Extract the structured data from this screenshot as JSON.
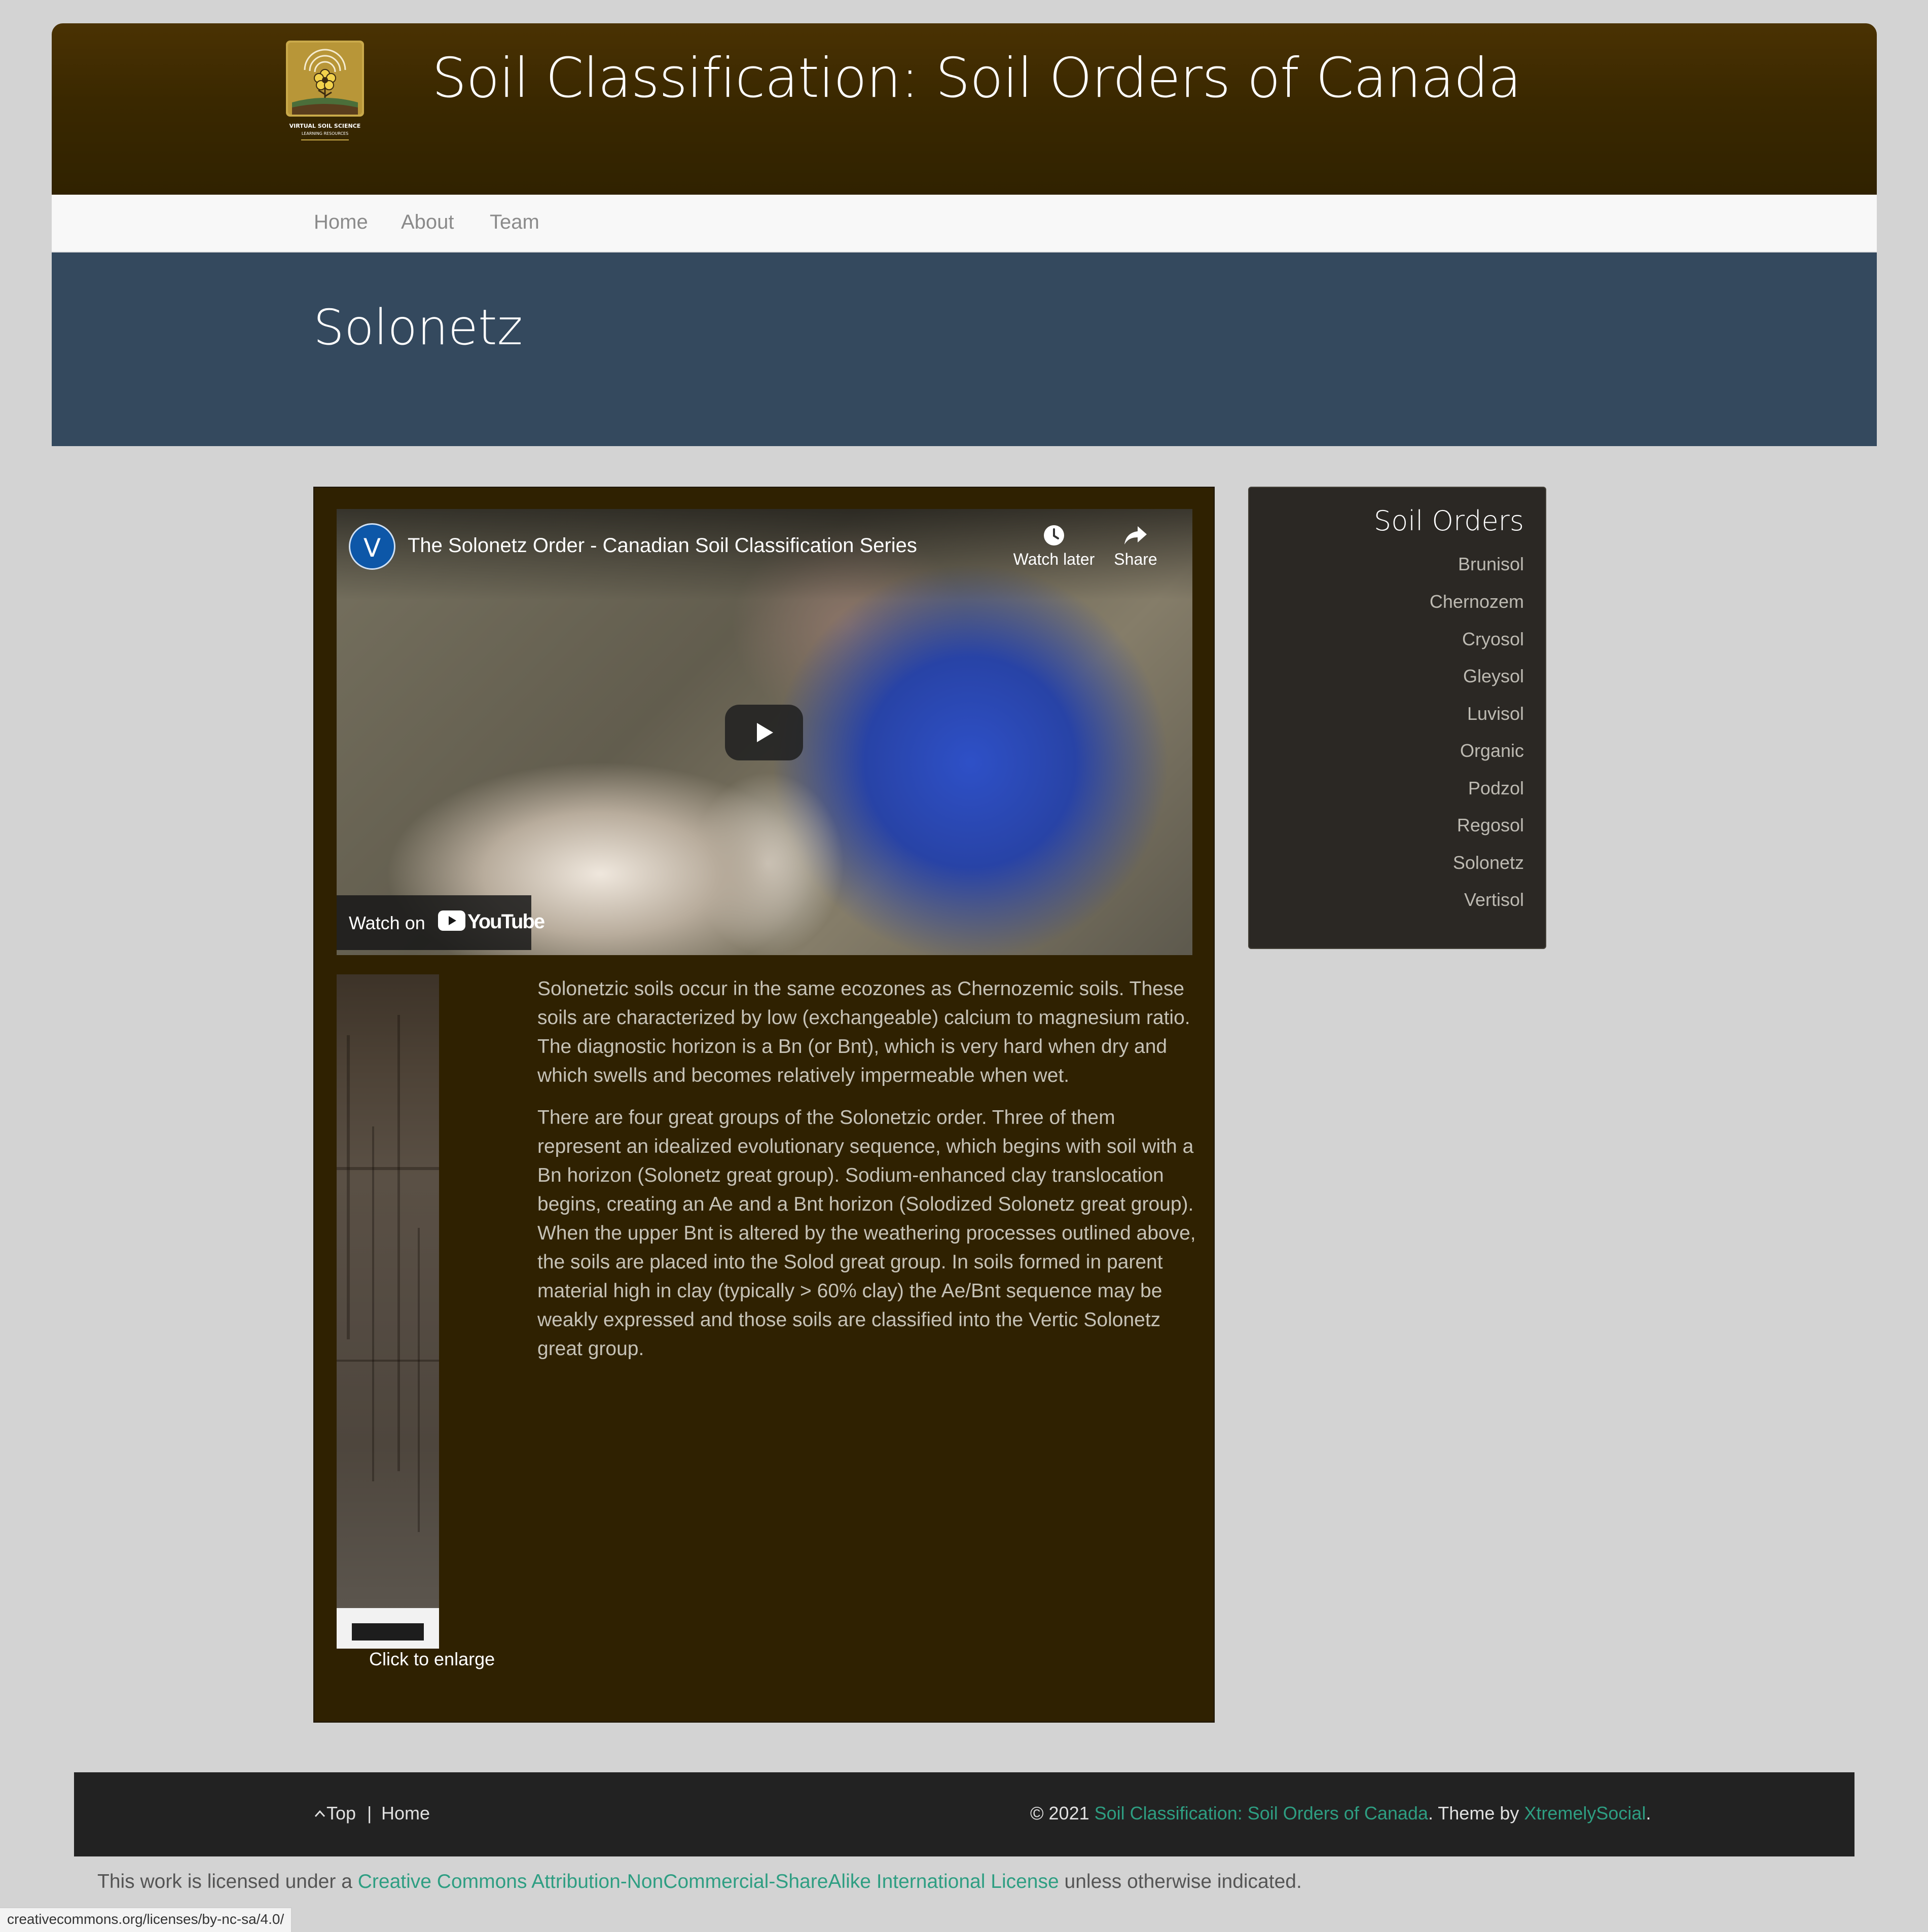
{
  "header": {
    "site_title": "Soil Classification: Soil Orders of Canada",
    "logo_text_1": "VIRTUAL SOIL SCIENCE",
    "logo_text_2": "LEARNING RESOURCES"
  },
  "nav": {
    "items": [
      {
        "label": "Home"
      },
      {
        "label": "About"
      },
      {
        "label": "Team"
      }
    ]
  },
  "banner": {
    "page_title": "Solonetz"
  },
  "video": {
    "channel_initial": "V",
    "title": "The Solonetz Order - Canadian Soil Classification Series",
    "watch_later_label": "Watch later",
    "share_label": "Share",
    "watch_on_label": "Watch on",
    "youtube_label": "YouTube",
    "icons": [
      "clock-icon",
      "share-arrow-icon",
      "play-icon",
      "youtube-logo-icon"
    ]
  },
  "figure": {
    "caption": "Click to enlarge"
  },
  "article": {
    "paragraphs": [
      "Solonetzic soils occur in the same ecozones as Chernozemic soils. These soils are characterized by low (exchangeable) calcium to magnesium ratio. The diagnostic horizon is a Bn (or Bnt), which is very hard when dry and which swells and becomes relatively impermeable when wet.",
      "There are four great groups of the Solonetzic order. Three of them represent an idealized evolutionary sequence, which begins with soil with a Bn horizon (Solonetz great group). Sodium-enhanced clay translocation begins, creating an Ae and a Bnt horizon (Solodized Solonetz great group). When the upper Bnt is altered by the weathering processes outlined above, the soils are placed into the Solod great group. In soils formed in parent material high in clay (typically > 60% clay) the Ae/Bnt sequence may be weakly expressed and those soils are classified into the Vertic Solonetz great group."
    ]
  },
  "sidebar": {
    "title": "Soil Orders",
    "items": [
      {
        "label": "Brunisol"
      },
      {
        "label": "Chernozem"
      },
      {
        "label": "Cryosol"
      },
      {
        "label": "Gleysol"
      },
      {
        "label": "Luvisol"
      },
      {
        "label": "Organic"
      },
      {
        "label": "Podzol"
      },
      {
        "label": "Regosol"
      },
      {
        "label": "Solonetz"
      },
      {
        "label": "Vertisol"
      }
    ]
  },
  "footer": {
    "top_label": "Top",
    "separator": "|",
    "home_label": "Home",
    "copyright_prefix": "© 2021 ",
    "site_link": "Soil Classification: Soil Orders of Canada",
    "theme_text": ". Theme by ",
    "theme_link": "XtremelySocial",
    "end_period": "."
  },
  "license": {
    "prefix": "This work is licensed under a ",
    "link": "Creative Commons Attribution-NonCommercial-ShareAlike International License",
    "suffix": " unless otherwise indicated."
  },
  "status_bar": {
    "url": "creativecommons.org/licenses/by-nc-sa/4.0/"
  },
  "colors": {
    "header_brown": "#3a2800",
    "banner_blue": "#34495e",
    "content_brown": "#2f2101",
    "sidebar_dark": "#2b2824",
    "footer_dark": "#222222",
    "link_green": "#2e9e82"
  }
}
